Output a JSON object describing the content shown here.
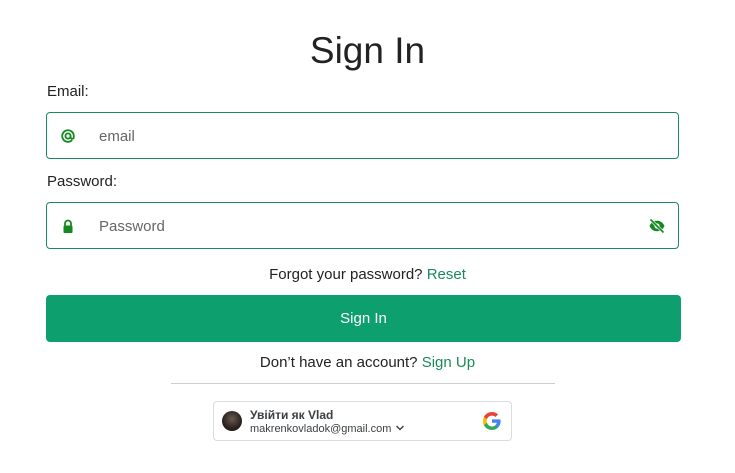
{
  "page": {
    "title": "Sign In"
  },
  "form": {
    "email_label": "Email:",
    "email_placeholder": "email",
    "email_value": "",
    "password_label": "Password:",
    "password_placeholder": "Password",
    "password_value": "",
    "forgot_text": "Forgot your password?",
    "reset_link": "Reset",
    "submit_label": "Sign In",
    "no_account_text": "Don’t have an account?",
    "signup_link": "Sign Up"
  },
  "google": {
    "signin_as": "Увійти як Vlad",
    "email": "makrenkovladok@gmail.com"
  },
  "icons": {
    "email_icon": "at-icon",
    "password_icon": "lock-icon",
    "visibility_icon": "eye-off-icon",
    "dropdown_icon": "chevron-down-icon",
    "google_icon": "google-logo-icon"
  },
  "colors": {
    "accent": "#1b8a5a",
    "button": "#0e9f6e",
    "icon": "#138a1f"
  }
}
